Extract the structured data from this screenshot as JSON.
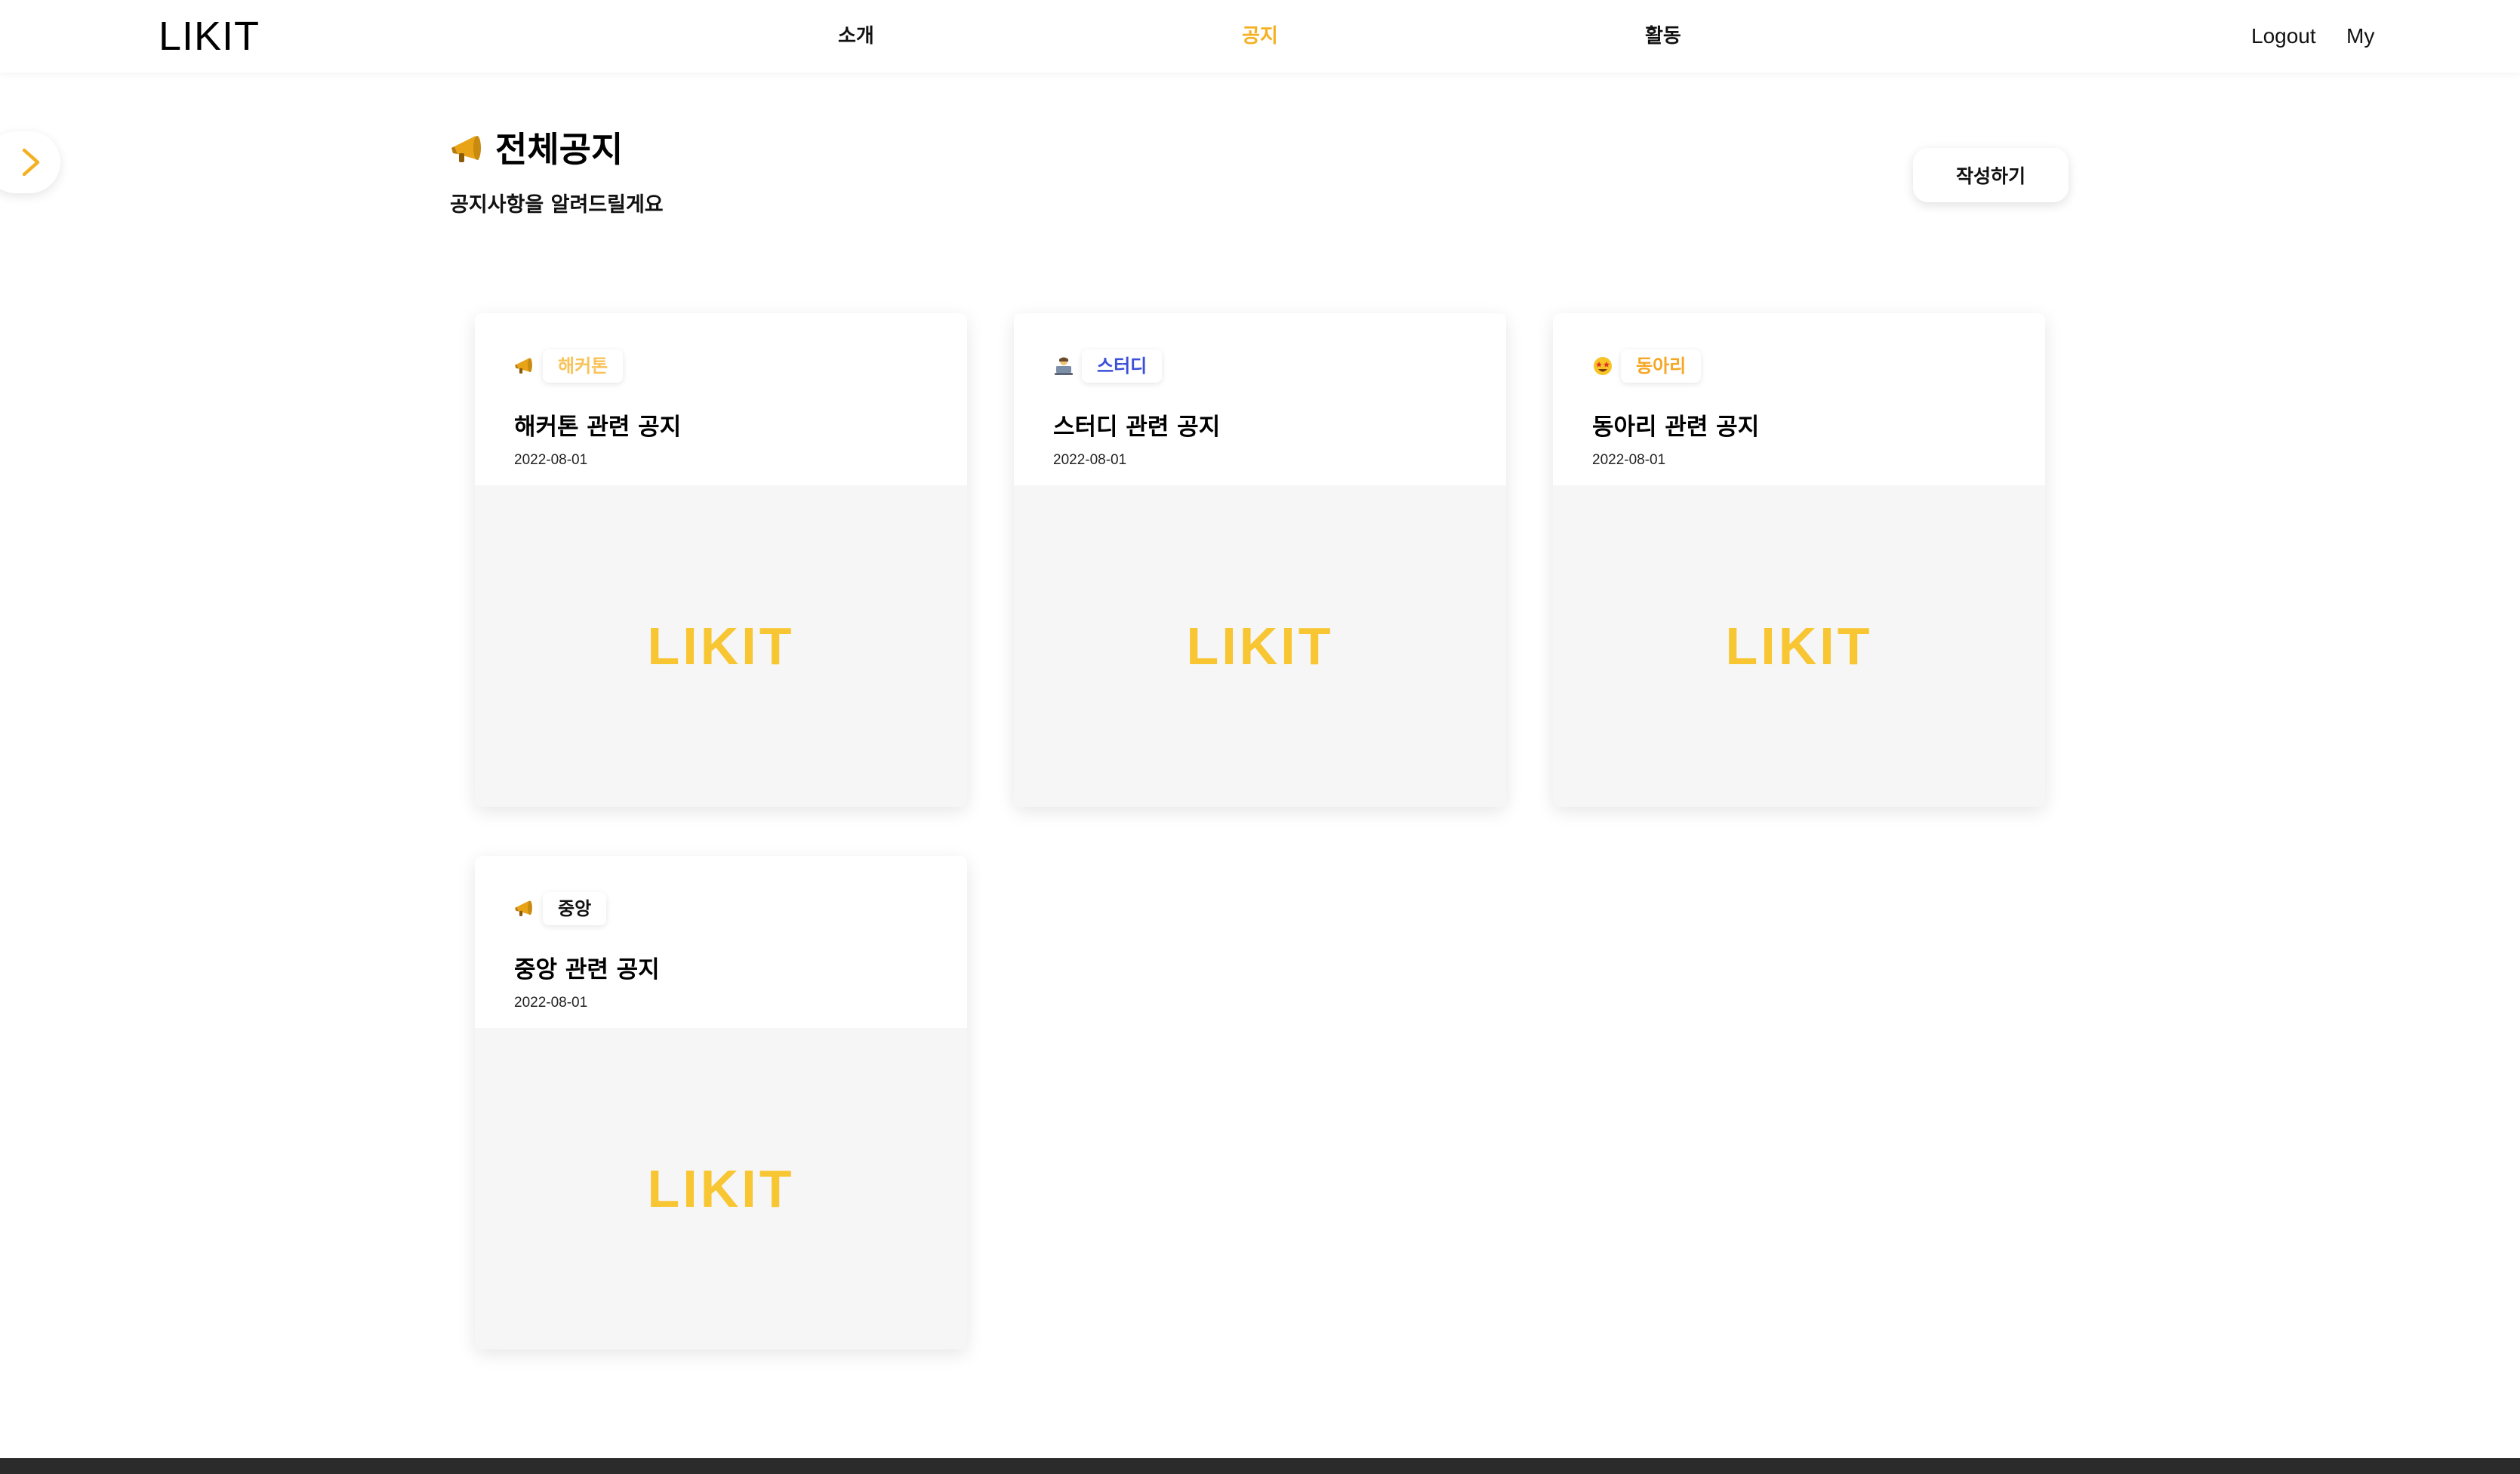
{
  "colors": {
    "accent": "#f5b021",
    "brand_logo": "#f8c632",
    "tag_hackathon": "#f7c35a",
    "tag_study": "#3b4fd8",
    "tag_club": "#f5a623",
    "tag_central": "#111111",
    "thumb_bg": "#f6f6f6",
    "footer": "#2b2b2b"
  },
  "header": {
    "logo": "LIKIT",
    "nav": [
      {
        "label": "소개",
        "active": false
      },
      {
        "label": "공지",
        "active": true
      },
      {
        "label": "활동",
        "active": false
      }
    ],
    "logout": "Logout",
    "my": "My"
  },
  "sidebar_toggle": {
    "icon": "chevron-right-icon"
  },
  "page": {
    "title_icon": "megaphone-icon",
    "title": "전체공지",
    "subtitle": "공지사항을 알려드릴게요",
    "write_button": "작성하기"
  },
  "cards": [
    {
      "tag_icon": "megaphone-icon",
      "tag": "해커톤",
      "title": "해커톤 관련 공지",
      "date": "2022-08-01",
      "thumb_logo": "LIKIT"
    },
    {
      "tag_icon": "person-at-computer-icon",
      "tag": "스터디",
      "title": "스터디 관련 공지",
      "date": "2022-08-01",
      "thumb_logo": "LIKIT"
    },
    {
      "tag_icon": "star-struck-face-icon",
      "tag": "동아리",
      "title": "동아리 관련 공지",
      "date": "2022-08-01",
      "thumb_logo": "LIKIT"
    },
    {
      "tag_icon": "megaphone-icon",
      "tag": "중앙",
      "title": "중앙 관련 공지",
      "date": "2022-08-01",
      "thumb_logo": "LIKIT"
    }
  ]
}
